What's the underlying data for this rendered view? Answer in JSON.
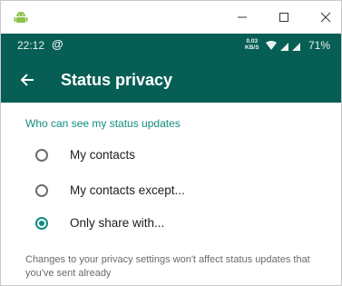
{
  "window": {
    "minimize_glyph": "—",
    "maximize_glyph": "☐",
    "close_glyph": "✕",
    "app_icon": "android-icon"
  },
  "status_bar": {
    "time": "22:12",
    "notification_glyph": "@",
    "data_speed_value": "0.03",
    "data_speed_unit": "KB/S",
    "battery": "71%"
  },
  "toolbar": {
    "title": "Status privacy",
    "back_icon": "arrow-left-icon"
  },
  "content": {
    "section_header": "Who can see my status updates",
    "options": [
      {
        "label": "My contacts",
        "selected": false
      },
      {
        "label": "My contacts except...",
        "selected": false
      },
      {
        "label": "Only share with...",
        "selected": true
      }
    ],
    "note": "Changes to your privacy settings won't affect status updates that you've sent already"
  },
  "colors": {
    "primary_dark": "#075e54",
    "accent": "#128c7e"
  }
}
